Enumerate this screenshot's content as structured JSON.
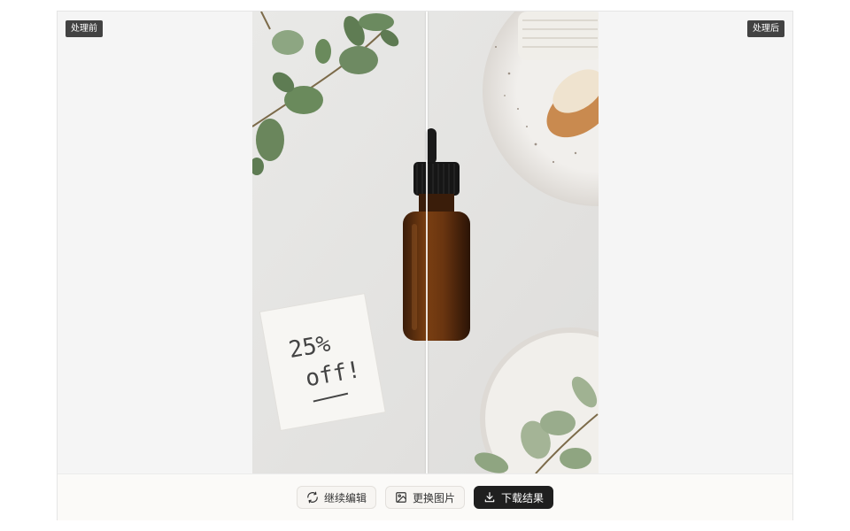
{
  "labels": {
    "before": "处理前",
    "after": "处理后"
  },
  "image": {
    "note_line1": "25%",
    "note_line2": "off!"
  },
  "toolbar": {
    "continue_edit": "继续编辑",
    "replace_image": "更换图片",
    "download_result": "下载结果"
  },
  "icons": {
    "continue_edit": "refresh-icon",
    "replace_image": "image-replace-icon",
    "download_result": "download-icon"
  },
  "colors": {
    "badge_bg": "#424242",
    "primary_button": "#1f1f1f",
    "canvas_bg": "#f5f5f5"
  }
}
